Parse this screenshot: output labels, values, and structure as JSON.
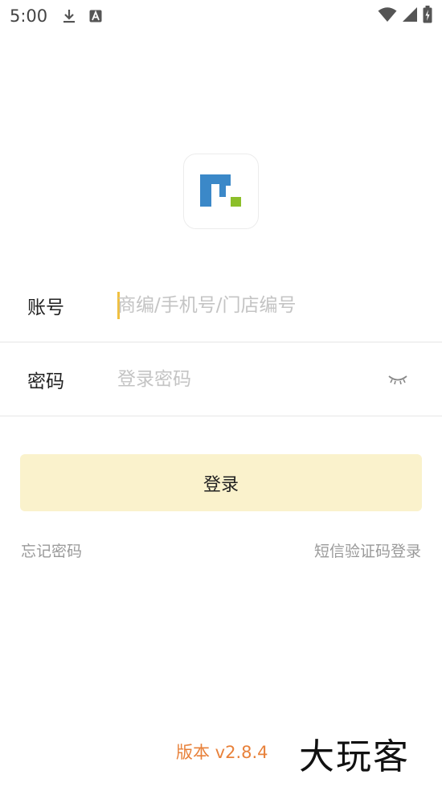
{
  "status_bar": {
    "time": "5:00",
    "icons": [
      "download-icon",
      "a-letter-icon",
      "wifi-icon",
      "signal-icon",
      "battery-icon"
    ]
  },
  "form": {
    "account": {
      "label": "账号",
      "placeholder": "商编/手机号/门店编号"
    },
    "password": {
      "label": "密码",
      "placeholder": "登录密码"
    }
  },
  "login_button": {
    "label": "登录"
  },
  "links": {
    "forgot_password": "忘记密码",
    "sms_login": "短信验证码登录"
  },
  "version": "版本 v2.8.4",
  "watermark": "大玩客",
  "colors": {
    "accent": "#f0c040",
    "login_button_bg": "#faf2cc",
    "version_text": "#e8813a",
    "logo_blue": "#3b88c8",
    "logo_green": "#8cbf2a"
  }
}
